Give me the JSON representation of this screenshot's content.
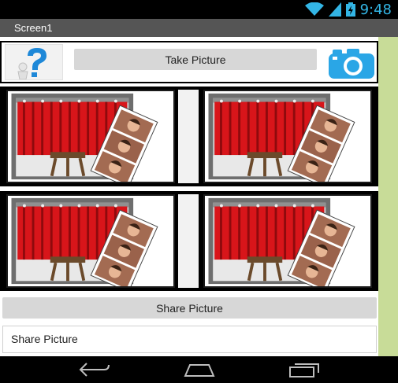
{
  "status_bar": {
    "time": "9:48",
    "icons": [
      "wifi-icon",
      "signal-icon",
      "battery-icon"
    ]
  },
  "title_bar": {
    "title": "Screen1"
  },
  "top_row": {
    "take_picture_label": "Take Picture",
    "help_image": "help-question-icon",
    "camera_icon": "camera-icon"
  },
  "photo_grid": {
    "images": [
      "photo-booth-image",
      "photo-booth-image",
      "photo-booth-image",
      "photo-booth-image"
    ]
  },
  "share_button_label": "Share Picture",
  "share_field_text": "Share Picture",
  "nav_bar": {
    "icons": [
      "back-icon",
      "home-icon",
      "recent-apps-icon"
    ]
  },
  "colors": {
    "accent": "#33b5e5",
    "title_bar": "#555555",
    "button": "#d7d7d7",
    "right_strip": "#c8dc98",
    "curtain": "#d8151a"
  }
}
